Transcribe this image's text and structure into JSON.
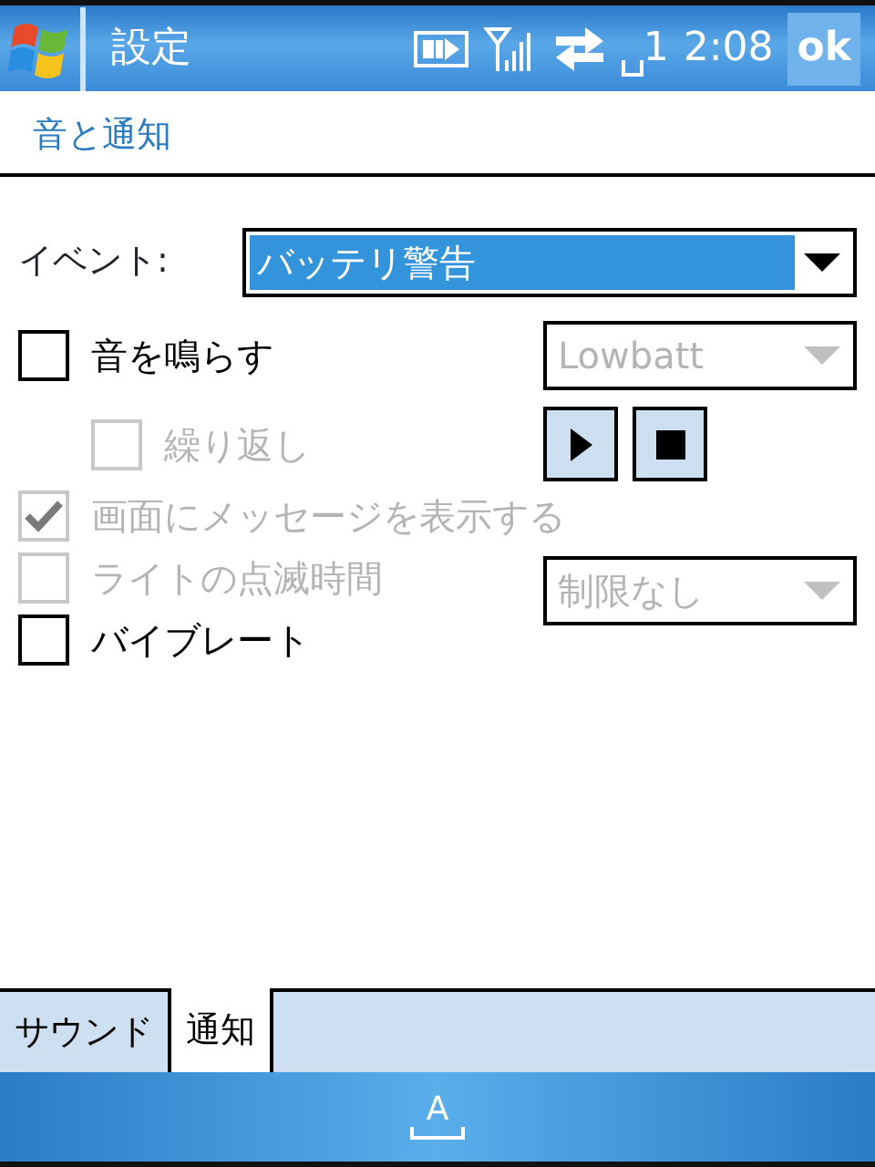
{
  "title_bar": {
    "title": "設定",
    "line_indicator": "1",
    "time": "2:08",
    "ok_button": "ok"
  },
  "page_title": "音と通知",
  "event": {
    "label": "イベント:",
    "value": "バッテリ警告"
  },
  "options": [
    {
      "label": "音を鳴らす",
      "checked": false,
      "disabled": false,
      "dropdown": {
        "value": "Lowbatt",
        "disabled": true
      },
      "children": [
        {
          "label": "繰り返し",
          "checked": false,
          "disabled": true,
          "playback": true
        }
      ]
    },
    {
      "label": "画面にメッセージを表示する",
      "checked": true,
      "disabled": true
    },
    {
      "label": "ライトの点滅時間",
      "checked": false,
      "disabled": true,
      "dropdown": {
        "value": "制限なし",
        "disabled": true
      }
    },
    {
      "label": "バイブレート",
      "checked": false,
      "disabled": false
    }
  ],
  "tabs": [
    {
      "label": "サウンド",
      "selected": false
    },
    {
      "label": "通知",
      "selected": true
    }
  ],
  "bottom_bar": {
    "input_button": "A"
  }
}
